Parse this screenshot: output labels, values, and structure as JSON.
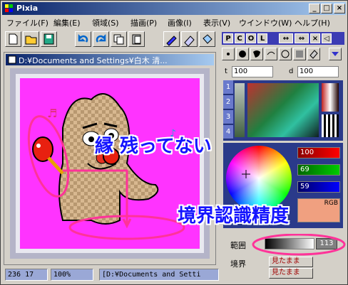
{
  "app": {
    "title": "Pixia"
  },
  "titlebar": {
    "minimize": "_",
    "maximize": "□",
    "close": "×"
  },
  "menu": {
    "items": [
      "ファイル(F)",
      "編集(E)",
      "領域(S)",
      "描画(P)",
      "画像(I)",
      "表示(V)",
      "ウインドウ(W)",
      "ヘルプ(H)"
    ]
  },
  "document": {
    "title": "D:¥Documents and Settings¥白木 清...",
    "close": "×"
  },
  "status": {
    "coords": "236 17",
    "zoom": "100%",
    "path": "[D:¥Documents and Setti"
  },
  "panel": {
    "tabs": [
      "P",
      "C",
      "O",
      "L"
    ],
    "t_label": "t",
    "t_value": "100",
    "d_label": "d",
    "d_value": "100",
    "palette_tabs": [
      "1",
      "2",
      "3",
      "4"
    ],
    "rgb_values": [
      "100",
      "69",
      "59"
    ],
    "rgb_mode": "RGB",
    "range_label": "範囲",
    "range_value": "113",
    "border_label": "境界",
    "mitamama1": "見たまま",
    "mitamama2": "見たまま"
  },
  "annotations": {
    "text1": "縁 残ってない",
    "text2": "境界認識精度"
  },
  "colors": {
    "canvas_bg": "#ff33ff",
    "annotation_blue": "#1414ff",
    "annotation_pink": "#ff3399",
    "titlebar_start": "#0a246a",
    "titlebar_end": "#a6caf0"
  }
}
